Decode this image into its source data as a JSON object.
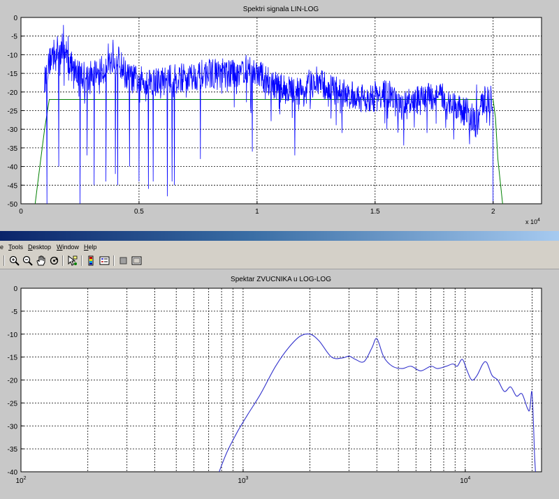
{
  "menu": {
    "edge": "e",
    "items": [
      "Tools",
      "Desktop",
      "Window",
      "Help"
    ]
  },
  "toolbar": {
    "icons": [
      "zoom-in-icon",
      "zoom-out-icon",
      "pan-hand-icon",
      "rotate-3d-icon",
      "data-cursor-icon",
      "colorbar-icon",
      "legend-icon",
      "hide-plot-tools-icon",
      "show-plot-tools-icon"
    ]
  },
  "colors": {
    "spectrum": "#0000ff",
    "envelope": "#008000",
    "grid": "#000000",
    "plot_bg": "#ffffff",
    "figure_bg": "#c8c8c8"
  },
  "chart_data": [
    {
      "type": "line",
      "title": "Spektri signala LIN-LOG",
      "xlabel": "",
      "ylabel": "",
      "x_multiplier": "x 10",
      "x_multiplier_exp": "4",
      "xlim": [
        0,
        22050
      ],
      "ylim": [
        -50,
        0
      ],
      "xticks": [
        0,
        5000,
        10000,
        15000,
        20000
      ],
      "xtick_labels": [
        "0",
        "0.5",
        "1",
        "1.5",
        "2"
      ],
      "yticks": [
        0,
        -5,
        -10,
        -15,
        -20,
        -25,
        -30,
        -35,
        -40,
        -45,
        -50
      ],
      "ytick_labels": [
        "0",
        "-5",
        "-10",
        "-15",
        "-20",
        "-25",
        "-30",
        "-35",
        "-40",
        "-45",
        "-50"
      ],
      "grid": true,
      "series": [
        {
          "color": "#0000ff",
          "style": "noisy",
          "envelope_x": [
            1000,
            1300,
            1500,
            1800,
            2200,
            2800,
            3500,
            4000,
            4500,
            5000,
            6000,
            7000,
            8000,
            9000,
            9500,
            10000,
            11000,
            12000,
            12500,
            13000,
            14000,
            15000,
            15500,
            16000,
            16500,
            17000,
            17500,
            18000,
            18500,
            19000,
            19300,
            19600,
            20000
          ],
          "envelope_y": [
            -17,
            -10,
            -9,
            -8,
            -14,
            -16,
            -14,
            -10,
            -16,
            -17,
            -17,
            -16,
            -15,
            -15,
            -14,
            -15,
            -19,
            -20,
            -17,
            -19,
            -21,
            -22,
            -20,
            -24,
            -23,
            -22,
            -21,
            -22,
            -24,
            -26,
            -29,
            -22,
            -22
          ],
          "peaks": [
            [
              1200,
              -12
            ],
            [
              1800,
              -2
            ],
            [
              2000,
              -5
            ],
            [
              3700,
              -7
            ],
            [
              3900,
              -6
            ],
            [
              9300,
              -13
            ],
            [
              12200,
              -14
            ],
            [
              13200,
              -16
            ],
            [
              15000,
              -17
            ],
            [
              19300,
              -18
            ]
          ],
          "dips": [
            [
              1100,
              -50
            ],
            [
              1600,
              -40
            ],
            [
              2500,
              -50
            ],
            [
              2800,
              -37
            ],
            [
              3100,
              -45
            ],
            [
              3600,
              -44
            ],
            [
              4000,
              -42
            ],
            [
              4100,
              -45
            ],
            [
              4600,
              -40
            ],
            [
              5000,
              -44
            ],
            [
              5400,
              -46
            ],
            [
              5600,
              -44
            ],
            [
              6200,
              -48
            ],
            [
              6400,
              -44
            ],
            [
              6500,
              -45
            ],
            [
              7600,
              -38
            ],
            [
              9800,
              -36
            ],
            [
              11600,
              -37
            ],
            [
              13600,
              -31
            ],
            [
              15500,
              -30
            ],
            [
              17200,
              -31
            ],
            [
              19000,
              -34
            ],
            [
              20000,
              -50
            ]
          ]
        },
        {
          "color": "#008000",
          "style": "line",
          "x": [
            600,
            800,
            1000,
            1200,
            20000,
            20100,
            20200,
            20400
          ],
          "y": [
            -50,
            -40,
            -30,
            -22,
            -22,
            -27,
            -38,
            -50
          ]
        }
      ]
    },
    {
      "type": "line",
      "title": "Spektar ZVUCNIKA u LOG-LOG",
      "xlabel": "",
      "ylabel": "",
      "xscale": "log",
      "xlim": [
        100,
        22050
      ],
      "ylim": [
        -40,
        0
      ],
      "xticks": [
        100,
        1000,
        10000
      ],
      "xtick_labels": [
        "10",
        "10",
        "10"
      ],
      "xtick_exps": [
        "2",
        "3",
        "4"
      ],
      "yticks": [
        0,
        -5,
        -10,
        -15,
        -20,
        -25,
        -30,
        -35,
        -40
      ],
      "ytick_labels": [
        "0",
        "-5",
        "-10",
        "-15",
        "-20",
        "-25",
        "-30",
        "-35",
        "-40"
      ],
      "grid": true,
      "series": [
        {
          "color": "#3333cc",
          "style": "smooth",
          "x": [
            780,
            850,
            950,
            1050,
            1200,
            1400,
            1600,
            1800,
            2000,
            2200,
            2500,
            2800,
            3000,
            3200,
            3500,
            3800,
            4000,
            4300,
            4700,
            5200,
            5700,
            6300,
            7000,
            7500,
            8200,
            8800,
            9200,
            9700,
            10200,
            10700,
            11300,
            12000,
            12500,
            13200,
            14000,
            15000,
            16000,
            17000,
            18000,
            19000,
            19500,
            19900,
            20100,
            20300,
            20500,
            20700
          ],
          "y": [
            -40,
            -35.5,
            -31,
            -27.5,
            -23,
            -17,
            -13,
            -10.5,
            -10,
            -11.5,
            -15,
            -15.2,
            -14.8,
            -15.5,
            -16,
            -13,
            -11,
            -15,
            -17,
            -17.5,
            -17,
            -18,
            -17,
            -17.5,
            -17,
            -16.5,
            -17,
            -15.5,
            -18,
            -20,
            -19,
            -16.5,
            -16.2,
            -19,
            -20,
            -22.5,
            -21.5,
            -23.5,
            -23,
            -26,
            -26.5,
            -22.5,
            -25,
            -30,
            -36,
            -40
          ]
        }
      ]
    }
  ]
}
